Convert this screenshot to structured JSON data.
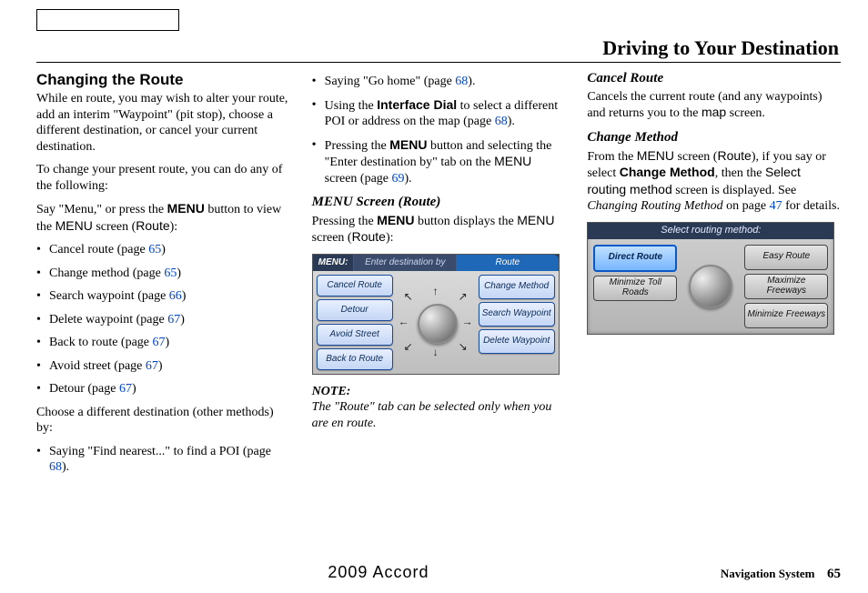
{
  "header": {
    "title": "Driving to Your Destination"
  },
  "col1": {
    "heading": "Changing the Route",
    "intro1": "While en route, you may wish to alter your route, add an interim \"Waypoint\" (pit stop), choose a different destination, or cancel your current destination.",
    "intro2": "To change your present route, you can do any of the following:",
    "lead": "Say \"Menu,\" or press the ",
    "lead_bold": "MENU",
    "lead2": " button to view the ",
    "lead_menu": "MENU",
    "lead3": " screen (",
    "lead_route": "Route",
    "lead4": "):",
    "bullets": [
      {
        "text": "Cancel route (page ",
        "page": "65",
        "tail": ")"
      },
      {
        "text": "Change method (page ",
        "page": "65",
        "tail": ")"
      },
      {
        "text": "Search waypoint (page ",
        "page": "66",
        "tail": ")"
      },
      {
        "text": "Delete waypoint (page ",
        "page": "67",
        "tail": ")"
      },
      {
        "text": "Back to route (page ",
        "page": "67",
        "tail": ")"
      },
      {
        "text": "Avoid street (page ",
        "page": "67",
        "tail": ")"
      },
      {
        "text": "Detour (page ",
        "page": "67",
        "tail": ")"
      }
    ],
    "other_lead": "Choose a different destination (other methods) by:",
    "other_b1_a": "Saying \"Find nearest...\" to find a POI (page ",
    "other_b1_page": "68",
    "other_b1_b": ")."
  },
  "col2": {
    "b1_a": "Saying \"Go home\" (page ",
    "b1_page": "68",
    "b1_b": ").",
    "b2_a": "Using the ",
    "b2_bold": "Interface Dial",
    "b2_b": " to select a different POI or address on the map (page ",
    "b2_page": "68",
    "b2_c": ").",
    "b3_a": "Pressing the ",
    "b3_bold": "MENU",
    "b3_b": " button and selecting the \"Enter destination by\" tab on the ",
    "b3_menu": "MENU",
    "b3_c": " screen (page ",
    "b3_page": "69",
    "b3_d": ").",
    "sub_heading": "MENU Screen (Route)",
    "sub_text_a": "Pressing the ",
    "sub_bold": "MENU",
    "sub_text_b": " button displays the ",
    "sub_menu": "MENU",
    "sub_text_c": " screen (",
    "sub_route": "Route",
    "sub_text_d": "):",
    "menu_label": "MENU:",
    "tab_inactive": "Enter destination by",
    "tab_active": "Route",
    "left_btns": [
      "Cancel Route",
      "Detour",
      "Avoid Street",
      "Back to Route"
    ],
    "right_btns": [
      "Change Method",
      "Search Waypoint",
      "Delete Waypoint"
    ],
    "note_label": "NOTE:",
    "note_body": "The \"Route\" tab can be selected only when you are en route."
  },
  "col3": {
    "h_cancel": "Cancel Route",
    "cancel_a": "Cancels the current route (and any waypoints) and returns you to the ",
    "cancel_map": "map",
    "cancel_b": " screen.",
    "h_change": "Change Method",
    "change_a": "From the ",
    "change_menu": "MENU",
    "change_b": " screen (",
    "change_route": "Route",
    "change_c": "), if you say or select ",
    "change_bold": "Change Method",
    "change_d": ", then the ",
    "change_srm": "Select routing method",
    "change_e": " screen is displayed. See ",
    "change_ital": "Changing Routing Method",
    "change_f": " on page ",
    "change_page": "47",
    "change_g": " for details.",
    "routing_title": "Select routing method:",
    "left_btns": [
      "Direct Route",
      "Minimize Toll Roads"
    ],
    "right_btns": [
      "Easy Route",
      "Maximize Freeways",
      "Minimize Freeways"
    ]
  },
  "footer": {
    "vehicle": "2009  Accord",
    "navsys": "Navigation System",
    "page": "65"
  }
}
